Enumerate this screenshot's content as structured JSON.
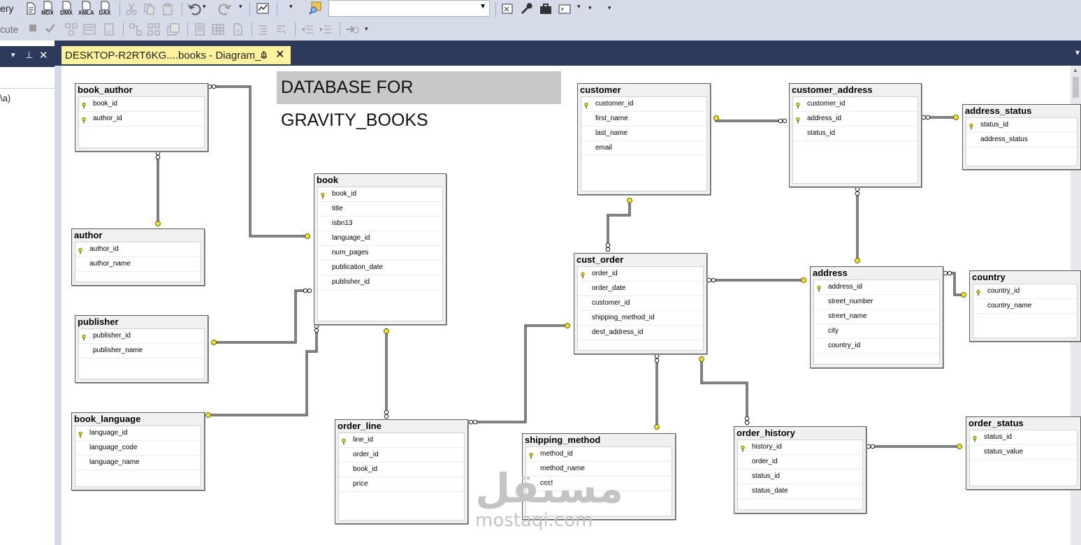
{
  "toolbar1": {
    "partial_label": "ery",
    "items": [
      {
        "name": "new-query-icon",
        "label": ""
      },
      {
        "name": "mdx-query-icon",
        "label": "MDX"
      },
      {
        "name": "dmx-query-icon",
        "label": "DMX"
      },
      {
        "name": "xmla-query-icon",
        "label": "XMLA"
      },
      {
        "name": "dax-query-icon",
        "label": "DAX"
      }
    ]
  },
  "toolbar2": {
    "execute_partial": "cute"
  },
  "left_panel": {
    "text": "\\a)"
  },
  "document_tab": {
    "title": "DESKTOP-R2RT6KG....books - Diagram_0"
  },
  "diagram": {
    "title": "DATABASE FOR GRAVITY_BOOKS",
    "tables": [
      {
        "id": "book_author",
        "name": "book_author",
        "columns": [
          {
            "name": "book_id",
            "pk": true
          },
          {
            "name": "author_id",
            "pk": true
          }
        ]
      },
      {
        "id": "author",
        "name": "author",
        "columns": [
          {
            "name": "author_id",
            "pk": true
          },
          {
            "name": "author_name",
            "pk": false
          }
        ]
      },
      {
        "id": "publisher",
        "name": "publisher",
        "columns": [
          {
            "name": "publisher_id",
            "pk": true
          },
          {
            "name": "publisher_name",
            "pk": false
          }
        ]
      },
      {
        "id": "book_language",
        "name": "book_language",
        "columns": [
          {
            "name": "language_id",
            "pk": true
          },
          {
            "name": "language_code",
            "pk": false
          },
          {
            "name": "language_name",
            "pk": false
          }
        ]
      },
      {
        "id": "book",
        "name": "book",
        "columns": [
          {
            "name": "book_id",
            "pk": true
          },
          {
            "name": "title",
            "pk": false
          },
          {
            "name": "isbn13",
            "pk": false
          },
          {
            "name": "language_id",
            "pk": false
          },
          {
            "name": "num_pages",
            "pk": false
          },
          {
            "name": "publication_date",
            "pk": false
          },
          {
            "name": "publisher_id",
            "pk": false
          }
        ]
      },
      {
        "id": "order_line",
        "name": "order_line",
        "columns": [
          {
            "name": "line_id",
            "pk": true
          },
          {
            "name": "order_id",
            "pk": false
          },
          {
            "name": "book_id",
            "pk": false
          },
          {
            "name": "price",
            "pk": false
          }
        ]
      },
      {
        "id": "customer",
        "name": "customer",
        "columns": [
          {
            "name": "customer_id",
            "pk": true
          },
          {
            "name": "first_name",
            "pk": false
          },
          {
            "name": "last_name",
            "pk": false
          },
          {
            "name": "email",
            "pk": false
          }
        ]
      },
      {
        "id": "cust_order",
        "name": "cust_order",
        "columns": [
          {
            "name": "order_id",
            "pk": true
          },
          {
            "name": "order_date",
            "pk": false
          },
          {
            "name": "customer_id",
            "pk": false
          },
          {
            "name": "shipping_method_id",
            "pk": false
          },
          {
            "name": "dest_address_id",
            "pk": false
          }
        ]
      },
      {
        "id": "shipping_method",
        "name": "shipping_method",
        "columns": [
          {
            "name": "method_id",
            "pk": true
          },
          {
            "name": "method_name",
            "pk": false
          },
          {
            "name": "cost",
            "pk": false
          }
        ]
      },
      {
        "id": "customer_address",
        "name": "customer_address",
        "columns": [
          {
            "name": "customer_id",
            "pk": true
          },
          {
            "name": "address_id",
            "pk": true
          },
          {
            "name": "status_id",
            "pk": false
          }
        ]
      },
      {
        "id": "address_status",
        "name": "address_status",
        "columns": [
          {
            "name": "status_id",
            "pk": true
          },
          {
            "name": "address_status",
            "pk": false
          }
        ]
      },
      {
        "id": "address",
        "name": "address",
        "columns": [
          {
            "name": "address_id",
            "pk": true
          },
          {
            "name": "street_number",
            "pk": false
          },
          {
            "name": "street_name",
            "pk": false
          },
          {
            "name": "city",
            "pk": false
          },
          {
            "name": "country_id",
            "pk": false
          }
        ]
      },
      {
        "id": "country",
        "name": "country",
        "columns": [
          {
            "name": "country_id",
            "pk": true
          },
          {
            "name": "country_name",
            "pk": false
          }
        ]
      },
      {
        "id": "order_history",
        "name": "order_history",
        "columns": [
          {
            "name": "history_id",
            "pk": true
          },
          {
            "name": "order_id",
            "pk": false
          },
          {
            "name": "status_id",
            "pk": false
          },
          {
            "name": "status_date",
            "pk": false
          }
        ]
      },
      {
        "id": "order_status",
        "name": "order_status",
        "columns": [
          {
            "name": "status_id",
            "pk": true
          },
          {
            "name": "status_value",
            "pk": false
          }
        ]
      }
    ]
  },
  "watermark": {
    "arabic": "مستقل",
    "latin": "mostaqi.com"
  },
  "colors": {
    "dark_chrome": "#2d3a5b",
    "tab_active": "#fff29d",
    "key_yellow": "#f2e600",
    "toolbar_bg": "#d6dbe9"
  }
}
